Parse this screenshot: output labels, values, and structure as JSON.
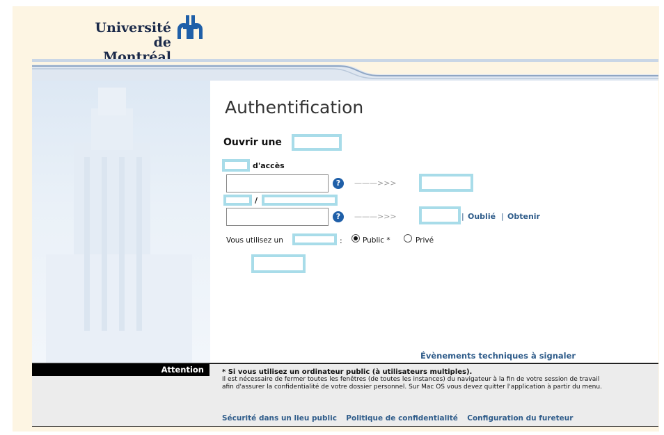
{
  "logo": {
    "line1": "Université",
    "line2": "de Montréal"
  },
  "title": "Authentification",
  "form": {
    "ouvrir_label": "Ouvrir une",
    "acces_label": "d'accès",
    "slash": "/",
    "forgot_separator": "|",
    "oublie_link": "Oublié",
    "obtenir_link": "Obtenir",
    "vous_utilisez": "Vous utilisez un",
    "colon": ":",
    "public_label": "Public *",
    "prive_label": "Privé",
    "arrow": "———>>>",
    "selected_computer": "Public"
  },
  "evenements_link": "Évènements techniques à signaler",
  "attention": {
    "label": "Attention",
    "heading": "* Si vous utilisez un ordinateur public (à utilisateurs multiples).",
    "text": "Il est nécessaire de fermer toutes les fenêtres (de toutes les instances) du navigateur à la fin de votre session de travail afin d'assurer la confidentialité de votre dossier personnel. Sur Mac OS vous devez quitter l'application à partir du menu."
  },
  "footer_links": [
    "Sécurité dans un lieu public",
    "Politique de confidentialité",
    "Configuration du fureteur"
  ],
  "colors": {
    "link": "#2f5c8a",
    "redaction": "#a8dce9",
    "help_icon": "#1f5fa8",
    "frame_bg": "#fdf5e3"
  }
}
